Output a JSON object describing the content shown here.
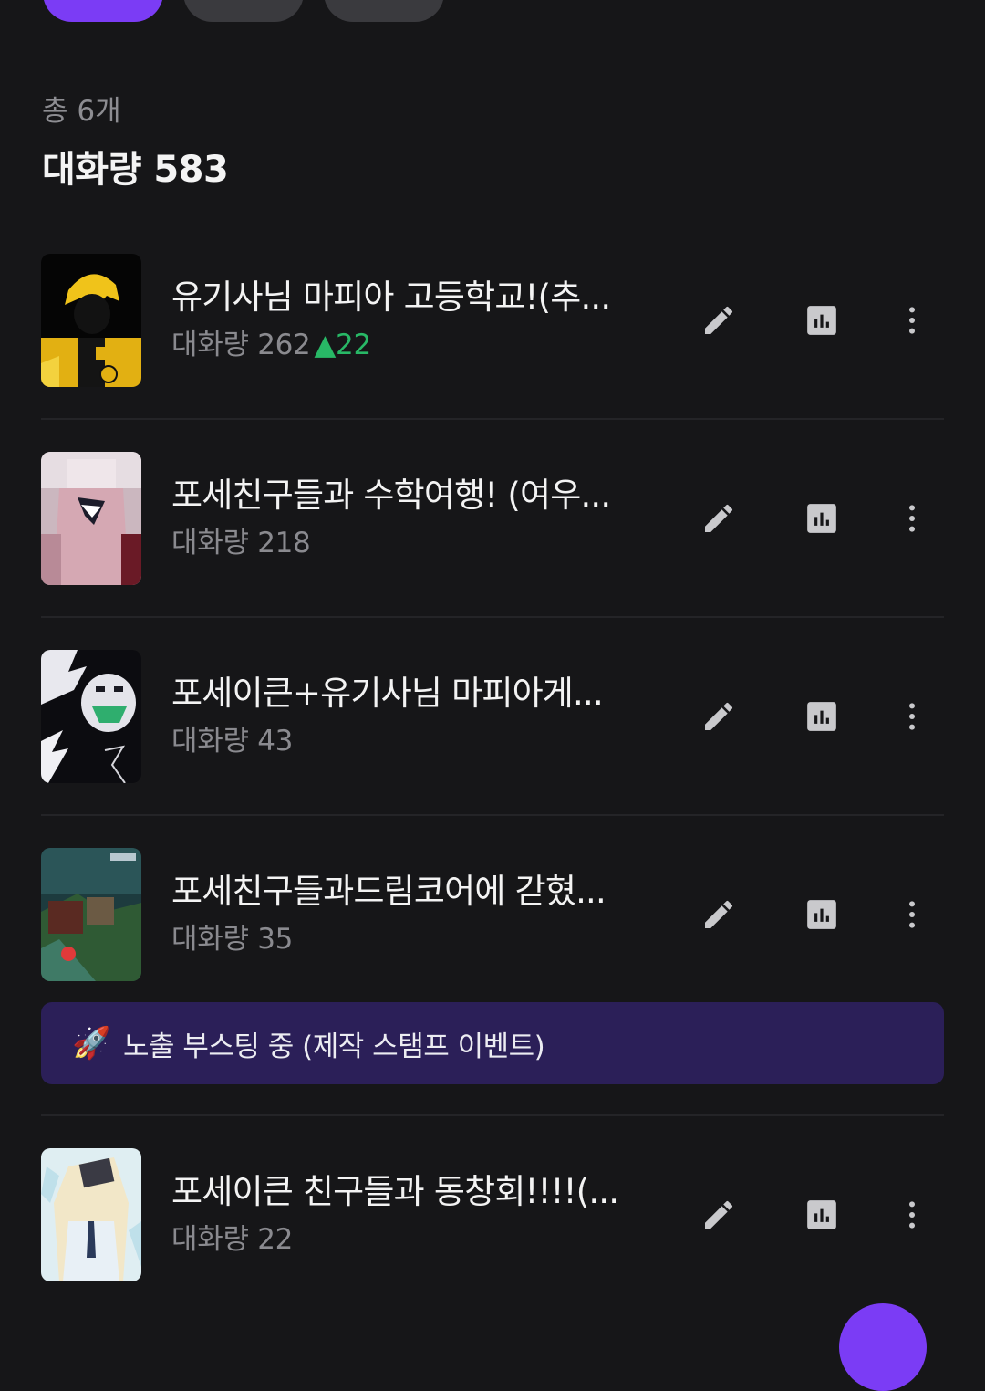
{
  "summary": {
    "count": "총 6개",
    "total": "대화량 583"
  },
  "items": [
    {
      "title": "유기사님 마피아 고등학교!(추...",
      "stat": "대화량 262",
      "change": "▲22"
    },
    {
      "title": "포세친구들과 수학여행! (여우...",
      "stat": "대화량 218",
      "change": ""
    },
    {
      "title": "포세이큰+유기사님 마피아게...",
      "stat": "대화량 43",
      "change": ""
    },
    {
      "title": "포세친구들과드림코어에 갇혔...",
      "stat": "대화량 35",
      "change": ""
    },
    {
      "title": "포세이큰 친구들과 동창회!!!!(...",
      "stat": "대화량 22",
      "change": ""
    }
  ],
  "banner": {
    "icon": "🚀",
    "text": "노출 부스팅 중 (제작 스탬프 이벤트)"
  },
  "icons": {
    "edit": "pencil-icon",
    "stats": "bar-chart-icon",
    "more": "more-vertical-icon"
  },
  "colors": {
    "background": "#161618",
    "accent": "#7b3cf5",
    "increase": "#28b866",
    "banner": "#2b1f58"
  }
}
